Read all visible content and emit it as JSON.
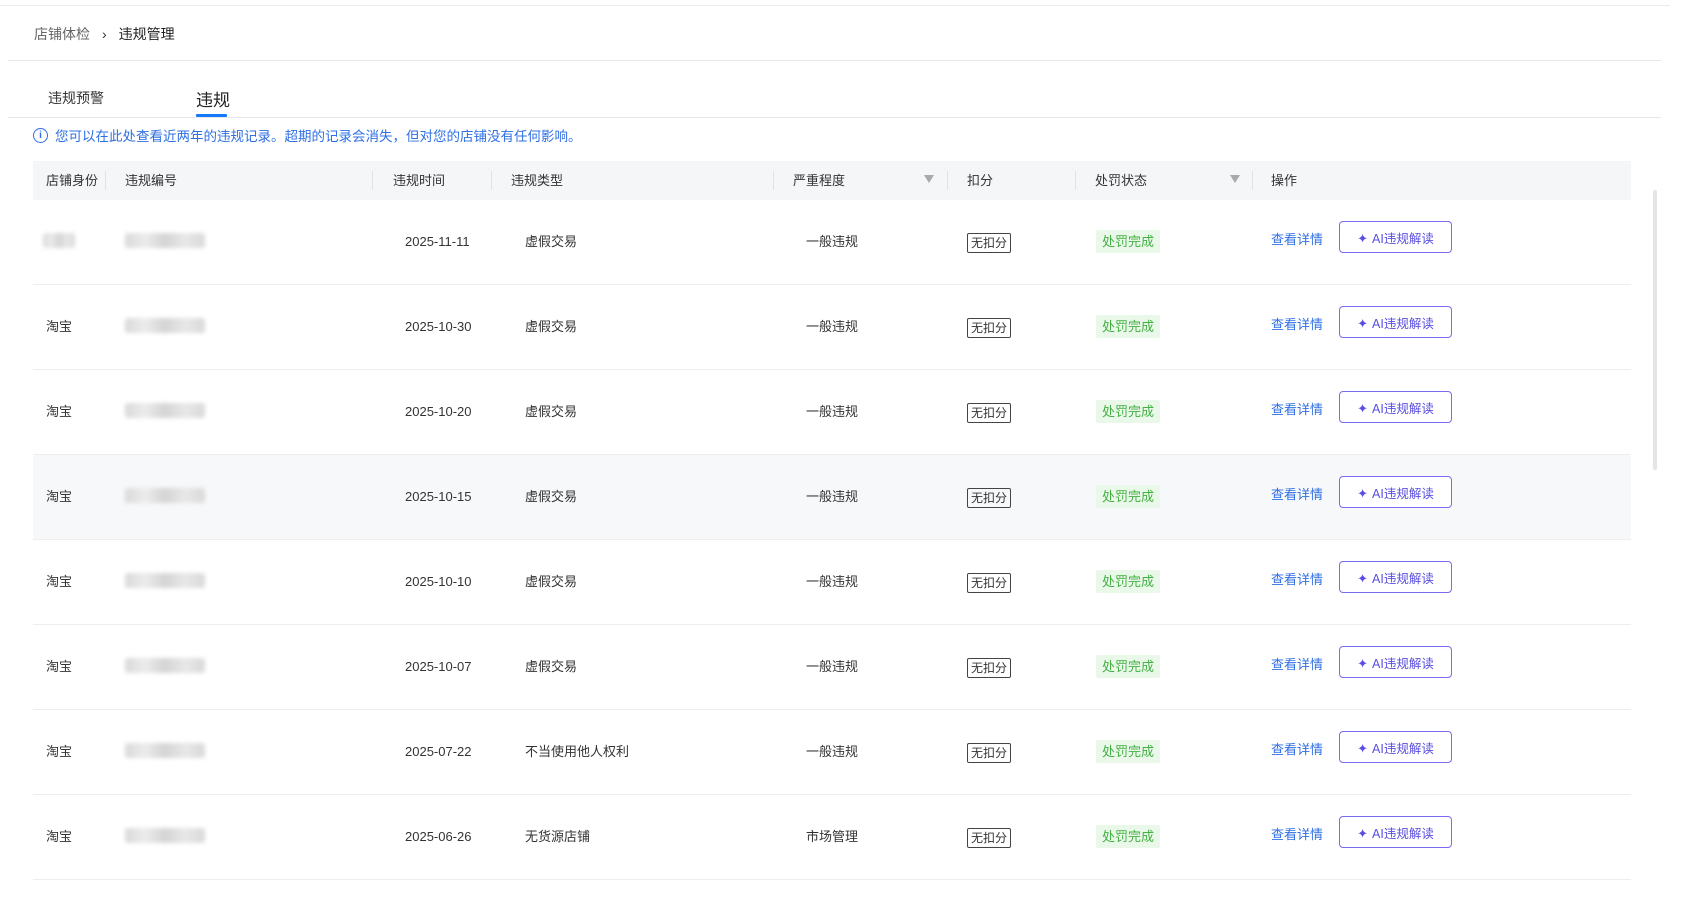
{
  "breadcrumb": {
    "root": "店铺体检",
    "separator": "›",
    "current": "违规管理"
  },
  "tabs": [
    {
      "label": "违规预警"
    },
    {
      "label": "违规"
    }
  ],
  "notice": {
    "text": "您可以在此处查看近两年的违规记录。超期的记录会消失，但对您的店铺没有任何影响。"
  },
  "table": {
    "headers": {
      "identity": "店铺身份",
      "number": "违规编号",
      "time": "违规时间",
      "type": "违规类型",
      "severity": "严重程度",
      "score": "扣分",
      "status": "处罚状态",
      "action": "操作"
    },
    "rows": [
      {
        "identity": "",
        "time": "2025-11-11",
        "type": "虚假交易",
        "severity": "一般违规",
        "score": "无扣分",
        "status": "处罚完成",
        "detail": "查看详情",
        "ai": "AI违规解读"
      },
      {
        "identity": "淘宝",
        "time": "2025-10-30",
        "type": "虚假交易",
        "severity": "一般违规",
        "score": "无扣分",
        "status": "处罚完成",
        "detail": "查看详情",
        "ai": "AI违规解读"
      },
      {
        "identity": "淘宝",
        "time": "2025-10-20",
        "type": "虚假交易",
        "severity": "一般违规",
        "score": "无扣分",
        "status": "处罚完成",
        "detail": "查看详情",
        "ai": "AI违规解读"
      },
      {
        "identity": "淘宝",
        "time": "2025-10-15",
        "type": "虚假交易",
        "severity": "一般违规",
        "score": "无扣分",
        "status": "处罚完成",
        "detail": "查看详情",
        "ai": "AI违规解读"
      },
      {
        "identity": "淘宝",
        "time": "2025-10-10",
        "type": "虚假交易",
        "severity": "一般违规",
        "score": "无扣分",
        "status": "处罚完成",
        "detail": "查看详情",
        "ai": "AI违规解读"
      },
      {
        "identity": "淘宝",
        "time": "2025-10-07",
        "type": "虚假交易",
        "severity": "一般违规",
        "score": "无扣分",
        "status": "处罚完成",
        "detail": "查看详情",
        "ai": "AI违规解读"
      },
      {
        "identity": "淘宝",
        "time": "2025-07-22",
        "type": "不当使用他人权利",
        "severity": "一般违规",
        "score": "无扣分",
        "status": "处罚完成",
        "detail": "查看详情",
        "ai": "AI违规解读"
      },
      {
        "identity": "淘宝",
        "time": "2025-06-26",
        "type": "无货源店铺",
        "severity": "市场管理",
        "score": "无扣分",
        "status": "处罚完成",
        "detail": "查看详情",
        "ai": "AI违规解读"
      }
    ]
  },
  "colors": {
    "accent": "#2f6fe4",
    "ai_border": "#7a6cf0",
    "status_green": "#43b043",
    "status_bg": "#eaf8ea"
  },
  "icons": {
    "notice": "info-icon",
    "breadcrumb_sep": "chevron-right-icon",
    "filter": "filter-icon",
    "ai": "sparkle-icon"
  }
}
